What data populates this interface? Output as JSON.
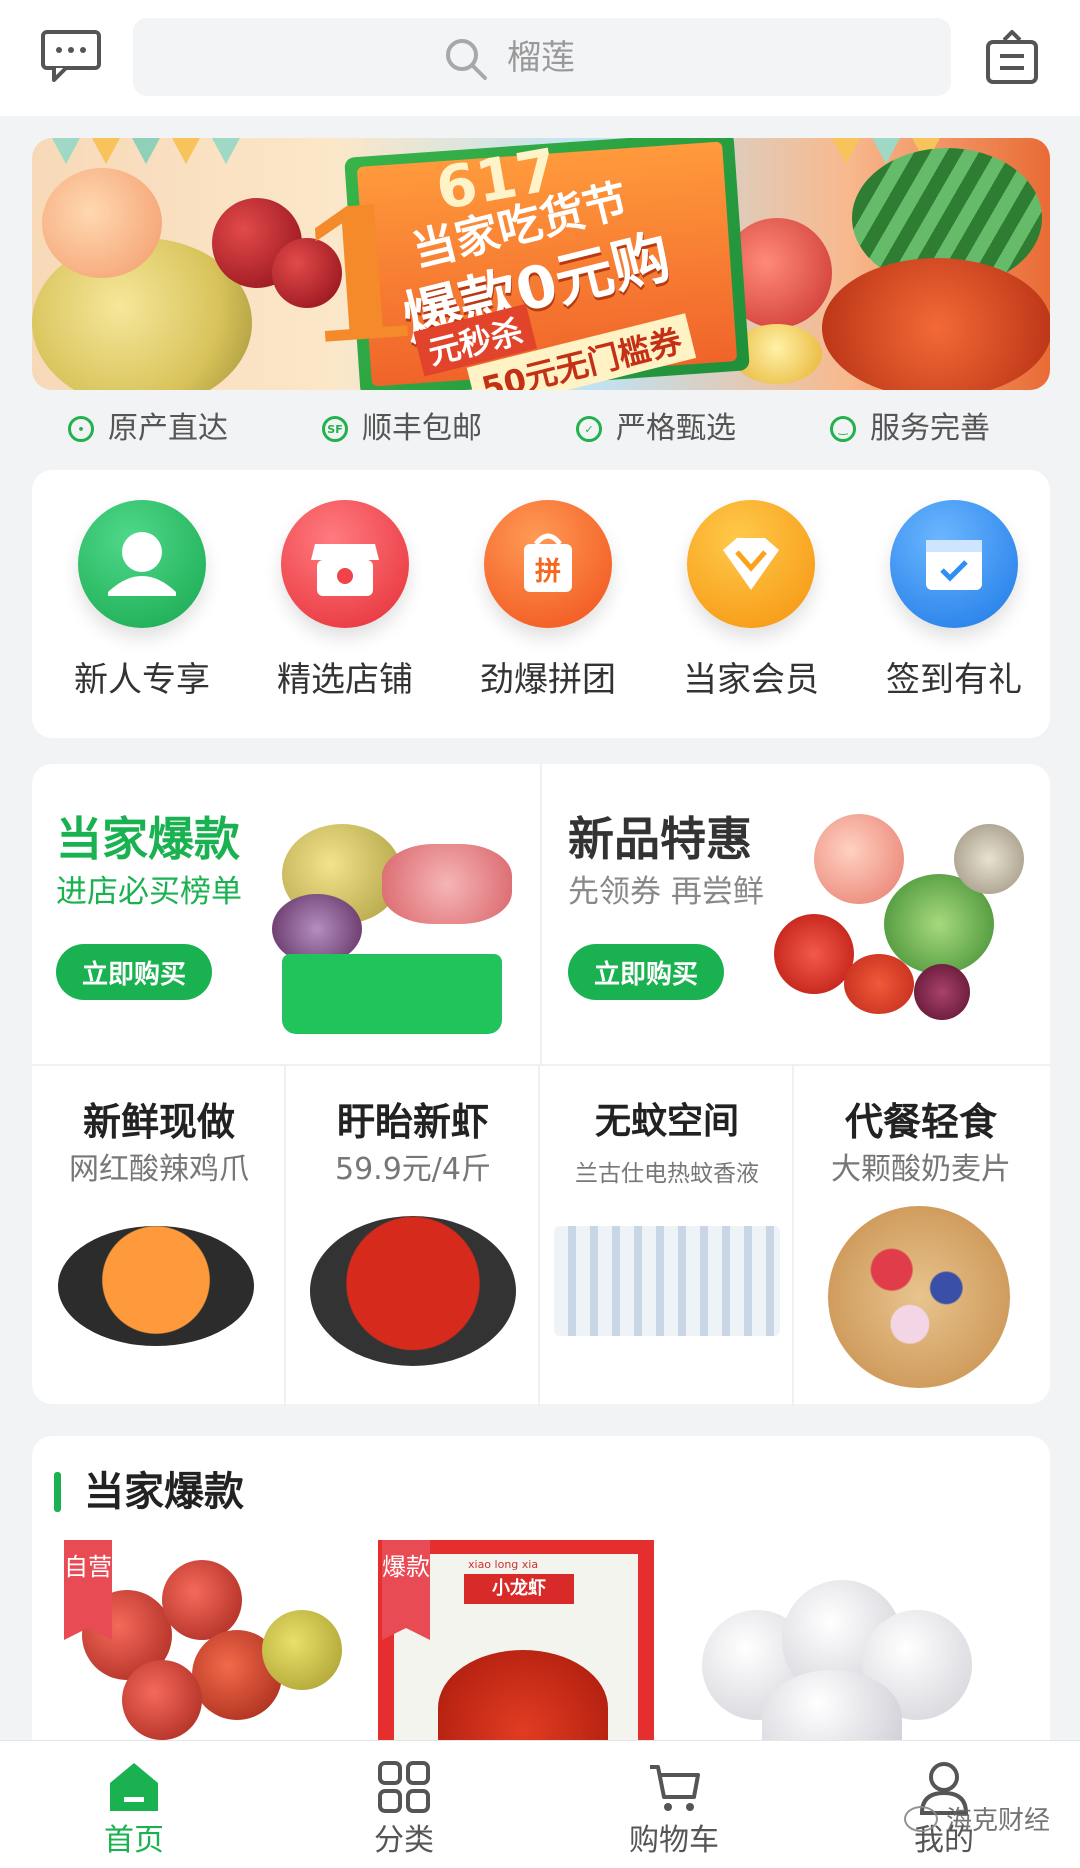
{
  "header": {
    "search_placeholder": "榴莲",
    "message_icon": "message-icon",
    "bag_icon": "bag-icon"
  },
  "banner": {
    "big_digit": "1",
    "event_number": "617",
    "line1": "当家吃货节",
    "line2": "爆款0元购",
    "line3": "元秒杀",
    "line4": "50元无门槛券"
  },
  "features": [
    {
      "icon": "location-icon",
      "label": "原产直达"
    },
    {
      "icon": "sf-icon",
      "label": "顺丰包邮"
    },
    {
      "icon": "shield-icon",
      "label": "严格甄选"
    },
    {
      "icon": "smile-icon",
      "label": "服务完善"
    }
  ],
  "quick_nav": [
    {
      "icon": "user-icon",
      "label": "新人专享",
      "color": "#1db462"
    },
    {
      "icon": "store-icon",
      "label": "精选店铺",
      "color": "#f0434a"
    },
    {
      "icon": "group-buy-icon",
      "label": "劲爆拼团",
      "color": "#f5661f"
    },
    {
      "icon": "diamond-icon",
      "label": "当家会员",
      "color": "#f9a21a"
    },
    {
      "icon": "calendar-check-icon",
      "label": "签到有礼",
      "color": "#2f8ff2"
    }
  ],
  "promos": [
    {
      "title": "当家爆款",
      "subtitle": "进店必买榜单",
      "button": "立即购买",
      "title_color": "#1ab150",
      "sub_color": "#1ab150"
    },
    {
      "title": "新品特惠",
      "subtitle": "先领券 再尝鲜",
      "button": "立即购买",
      "title_color": "#333333",
      "sub_color": "#888888"
    }
  ],
  "grid": [
    {
      "title": "新鲜现做",
      "subtitle": "网红酸辣鸡爪"
    },
    {
      "title": "盱眙新虾",
      "subtitle": "59.9元/4斤"
    },
    {
      "title": "无蚊空间",
      "subtitle": "兰古仕电热蚊香液"
    },
    {
      "title": "代餐轻食",
      "subtitle": "大颗酸奶麦片"
    }
  ],
  "hot": {
    "title": "当家爆款",
    "tags": [
      "自营",
      "爆款"
    ],
    "crawfish_box": {
      "pinyin": "xiao long xia",
      "title": "小龙虾"
    }
  },
  "tabbar": [
    {
      "icon": "home-icon",
      "label": "首页",
      "active": true
    },
    {
      "icon": "category-icon",
      "label": "分类",
      "active": false
    },
    {
      "icon": "cart-icon",
      "label": "购物车",
      "active": false
    },
    {
      "icon": "profile-icon",
      "label": "我的",
      "active": false
    }
  ],
  "watermark": "海克财经",
  "brand_green": "#1ab150"
}
